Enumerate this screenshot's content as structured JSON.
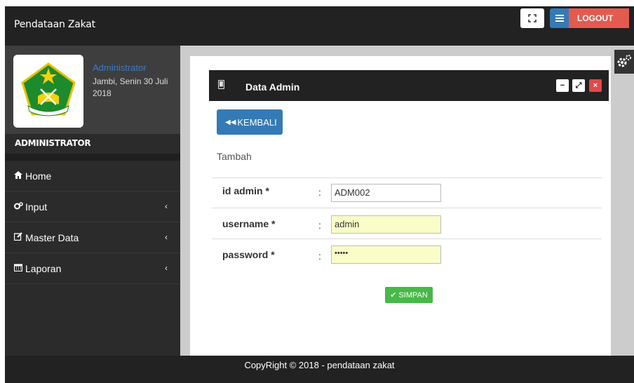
{
  "header": {
    "app_title": "Pendataan Zakat",
    "logout_label": "LOGOUT"
  },
  "sidebar": {
    "role": "Administrator",
    "date": "Jambi, Senin 30 Juli 2018",
    "section": "ADMINISTRATOR",
    "items": [
      {
        "label": "Home",
        "icon": "home-icon"
      },
      {
        "label": "Input",
        "icon": "cogs-icon"
      },
      {
        "label": "Master Data",
        "icon": "edit-icon"
      },
      {
        "label": "Laporan",
        "icon": "calendar-icon"
      }
    ]
  },
  "panel": {
    "title": "Data Admin",
    "back_label": "KEMBALI",
    "form_title": "Tambah"
  },
  "form": {
    "id_label": "id admin *",
    "id_value": "ADM002",
    "username_label": "username *",
    "username_value": "admin",
    "password_label": "password *",
    "password_value": "•••••",
    "colon": ":",
    "save_label": "SIMPAN"
  },
  "footer": {
    "text": "CopyRight © 2018 - pendataan zakat"
  },
  "colors": {
    "primary": "#337ab7",
    "danger": "#e55a4e",
    "success": "#46b946",
    "dark": "#222222"
  }
}
